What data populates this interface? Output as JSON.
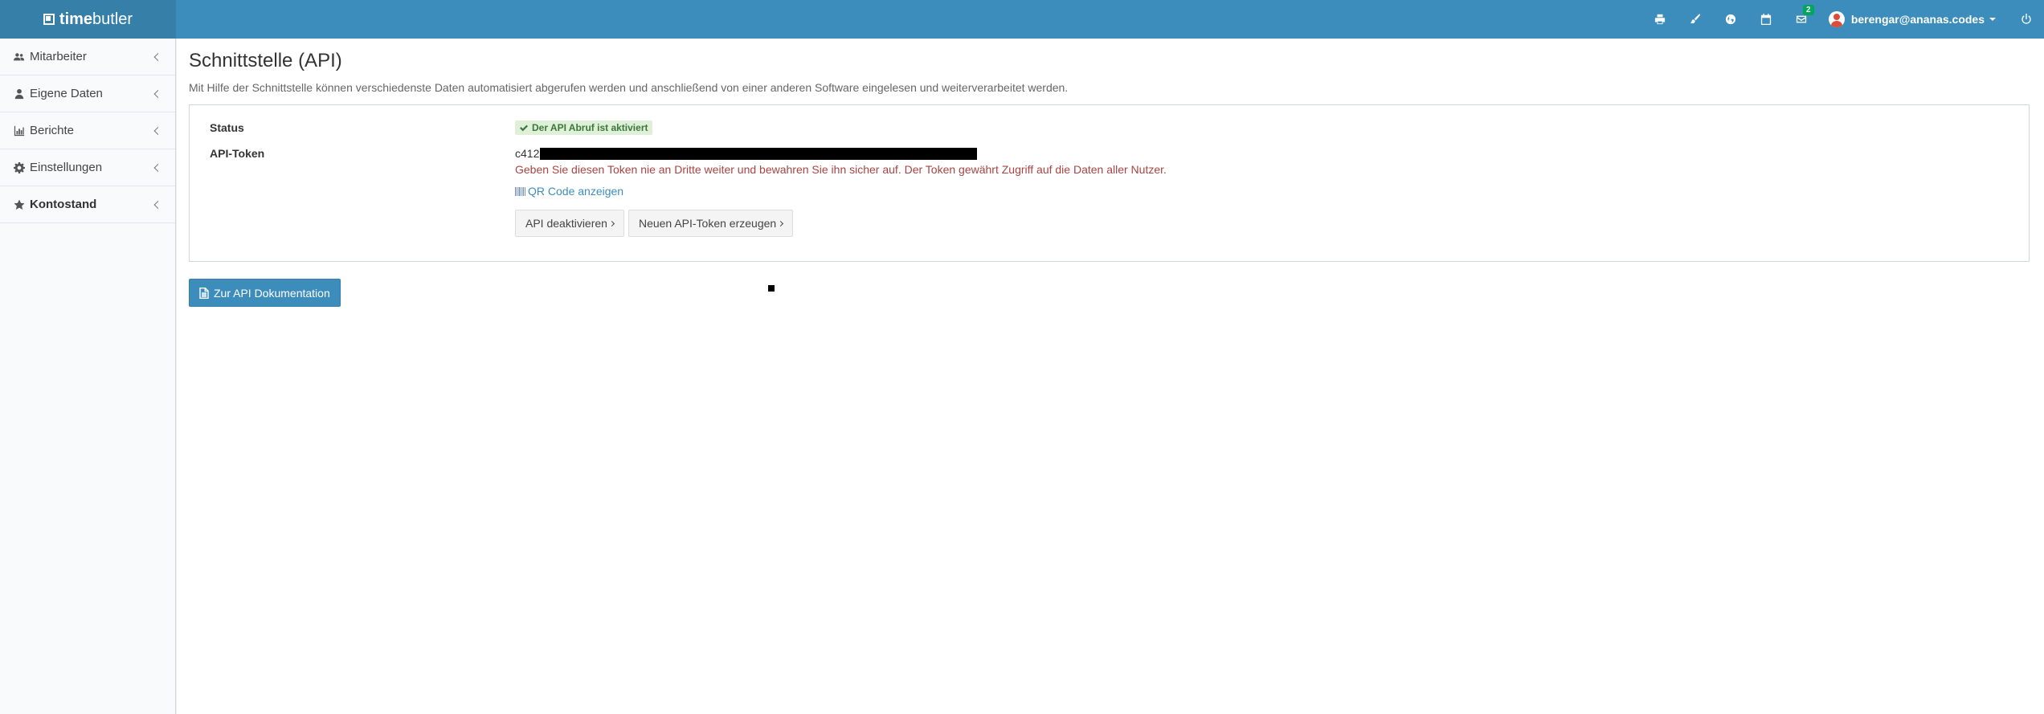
{
  "brand": {
    "bold": "time",
    "light": "butler"
  },
  "header": {
    "icons": [
      "print-icon",
      "paint-brush-icon",
      "globe-icon",
      "calendar-icon",
      "envelope-icon",
      "power-icon"
    ],
    "messages_badge": "2",
    "user_email": "berengar@ananas.codes"
  },
  "sidebar": {
    "items": [
      {
        "label": "Mitarbeiter",
        "icon": "users-icon"
      },
      {
        "label": "Eigene Daten",
        "icon": "user-icon"
      },
      {
        "label": "Berichte",
        "icon": "bar-chart-icon"
      },
      {
        "label": "Einstellungen",
        "icon": "cog-icon"
      },
      {
        "label": "Kontostand",
        "icon": "star-icon"
      }
    ]
  },
  "main": {
    "title": "Schnittstelle (API)",
    "description": "Mit Hilfe der Schnittstelle können verschiedenste Daten automatisiert abgerufen werden und anschließend von einer anderen Software eingelesen und weiterverarbeitet werden.",
    "status_label": "Status",
    "status_value": "Der API Abruf ist aktiviert",
    "token_label": "API-Token",
    "token_prefix": "c412",
    "token_warning": "Geben Sie diesen Token nie an Dritte weiter und bewahren Sie ihn sicher auf. Der Token gewährt Zugriff auf die Daten aller Nutzer.",
    "qr_link": "QR Code anzeigen",
    "deactivate_button": "API deaktivieren",
    "new_token_button": "Neuen API-Token erzeugen",
    "docs_button": "Zur API Dokumentation"
  },
  "colors": {
    "header": "#3c8dbc",
    "logo_bg": "#367fa9",
    "success_bg": "#dff0d8",
    "warning_text": "#a94442",
    "badge_green": "#00a65a"
  }
}
